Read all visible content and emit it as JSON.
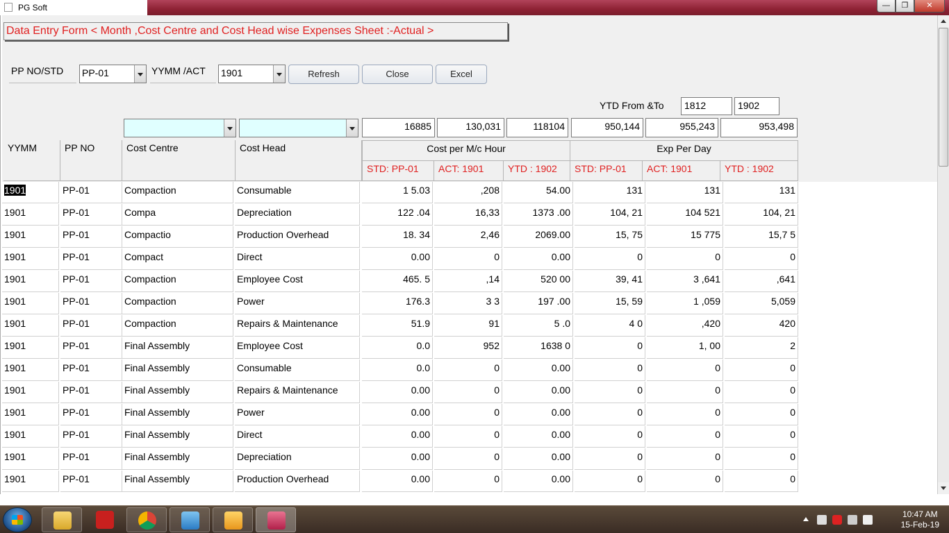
{
  "window": {
    "title": "PG Soft",
    "min": "—",
    "max": "❐",
    "close": "✕"
  },
  "form": {
    "title": "Data Entry Form < Month ,Cost Centre and Cost Head wise Expenses Sheet :-Actual >",
    "pp_no_label": "PP NO/STD",
    "pp_no_value": "PP-01",
    "yymm_label": "YYMM /ACT",
    "yymm_value": "1901",
    "refresh": "Refresh",
    "close": "Close",
    "excel": "Excel",
    "ytd_label": "YTD  From &To",
    "ytd_from": "1812",
    "ytd_to": "1902",
    "filter_cost_centre": "",
    "filter_cost_head": ""
  },
  "totals": [
    "16885",
    "130,031",
    "118104",
    "950,144",
    "955,243",
    "953,498"
  ],
  "headers": {
    "yymm": "YYMM",
    "ppno": "PP NO",
    "cost_centre": "Cost Centre",
    "cost_head": "Cost Head",
    "group1": "Cost per M/c Hour",
    "group2": "Exp Per Day",
    "sub": [
      "STD: PP-01",
      "ACT: 1901",
      "YTD : 1902",
      "STD: PP-01",
      "ACT: 1901",
      "YTD : 1902"
    ]
  },
  "rows": [
    [
      "1901",
      "PP-01",
      "Compaction",
      "Consumable",
      "1 5.03",
      ",208",
      "54.00",
      "131",
      "131",
      "131"
    ],
    [
      "1901",
      "PP-01",
      "Compa",
      "Depreciation",
      "122 .04",
      "16,33",
      "1373 .00",
      "104, 21",
      "104 521",
      "104, 21"
    ],
    [
      "1901",
      "PP-01",
      "Compactio",
      "Production Overhead",
      "18. 34",
      "2,46",
      "2069.00",
      "15, 75",
      "15 775",
      "15,7 5"
    ],
    [
      "1901",
      "PP-01",
      "Compact",
      "Direct",
      "0.00",
      "0",
      "0.00",
      "0",
      "0",
      "0"
    ],
    [
      "1901",
      "PP-01",
      "Compaction",
      "Employee Cost",
      "465. 5",
      ",14",
      "520 00",
      "39, 41",
      "3 ,641",
      ",641"
    ],
    [
      "1901",
      "PP-01",
      "Compaction",
      "Power",
      "176.3",
      "3 3",
      "197 .00",
      "15, 59",
      "1 ,059",
      "5,059"
    ],
    [
      "1901",
      "PP-01",
      "Compaction",
      "Repairs & Maintenance",
      "51.9",
      "91",
      "5 .0",
      "4 0",
      ",420",
      "420"
    ],
    [
      "1901",
      "PP-01",
      "Final Assembly",
      "Employee Cost",
      "0.0",
      "952",
      "1638 0",
      "0",
      "1, 00",
      "2"
    ],
    [
      "1901",
      "PP-01",
      "Final Assembly",
      "Consumable",
      "0.0",
      "0",
      "0.00",
      "0",
      "0",
      "0"
    ],
    [
      "1901",
      "PP-01",
      "Final Assembly",
      "Repairs & Maintenance",
      "0.00",
      "0",
      "0.00",
      "0",
      "0",
      "0"
    ],
    [
      "1901",
      "PP-01",
      "Final Assembly",
      "Power",
      "0.00",
      "0",
      "0.00",
      "0",
      "0",
      "0"
    ],
    [
      "1901",
      "PP-01",
      "Final Assembly",
      "Direct",
      "0.00",
      "0",
      "0.00",
      "0",
      "0",
      "0"
    ],
    [
      "1901",
      "PP-01",
      "Final Assembly",
      "Depreciation",
      "0.00",
      "0",
      "0.00",
      "0",
      "0",
      "0"
    ],
    [
      "1901",
      "PP-01",
      "Final Assembly",
      "Production Overhead",
      "0.00",
      "0",
      "0.00",
      "0",
      "0",
      "0"
    ]
  ],
  "taskbar": {
    "time": "10:47 AM",
    "date": "15-Feb-19",
    "apps": [
      "folder-app",
      "pdf-app",
      "chrome-app",
      "media-app",
      "outlook-app",
      "access-app"
    ]
  }
}
